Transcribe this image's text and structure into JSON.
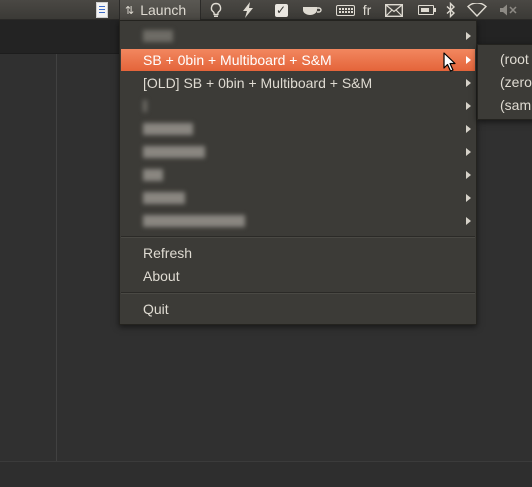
{
  "panel": {
    "launch_label": "Launch",
    "launch_arrows": "⇅",
    "language": "fr",
    "icons": [
      "document-icon",
      "launch-icon",
      "lightbulb-icon",
      "lightning-icon",
      "checkbox-icon",
      "coffee-cup-icon",
      "keyboard-icon",
      "mail-icon",
      "battery-icon",
      "bluetooth-icon",
      "wifi-icon",
      "volume-muted-icon"
    ]
  },
  "menu": {
    "items": [
      {
        "label": "",
        "redacted": true,
        "has_submenu": true
      },
      {
        "label": "SB + 0bin + Multiboard + S&M",
        "has_submenu": true,
        "highlighted": true
      },
      {
        "label": "[OLD] SB + 0bin + Multiboard + S&M",
        "has_submenu": true
      },
      {
        "label": "",
        "redacted": true,
        "has_submenu": true
      },
      {
        "label": "",
        "redacted": true,
        "has_submenu": true
      },
      {
        "label": "",
        "redacted": true,
        "has_submenu": true
      },
      {
        "label": "",
        "redacted": true,
        "has_submenu": true
      },
      {
        "label": "",
        "redacted": true,
        "has_submenu": true
      },
      {
        "label": "",
        "redacted": true,
        "has_submenu": true
      }
    ],
    "refresh_label": "Refresh",
    "about_label": "About",
    "quit_label": "Quit"
  },
  "submenu": {
    "items": [
      "(root",
      "(zero",
      "(sam"
    ]
  },
  "colors": {
    "highlight_top": "#f2875f",
    "highlight_bottom": "#e4643a",
    "menu_bg": "#3c3b37",
    "menu_text": "#dfdbd2"
  }
}
